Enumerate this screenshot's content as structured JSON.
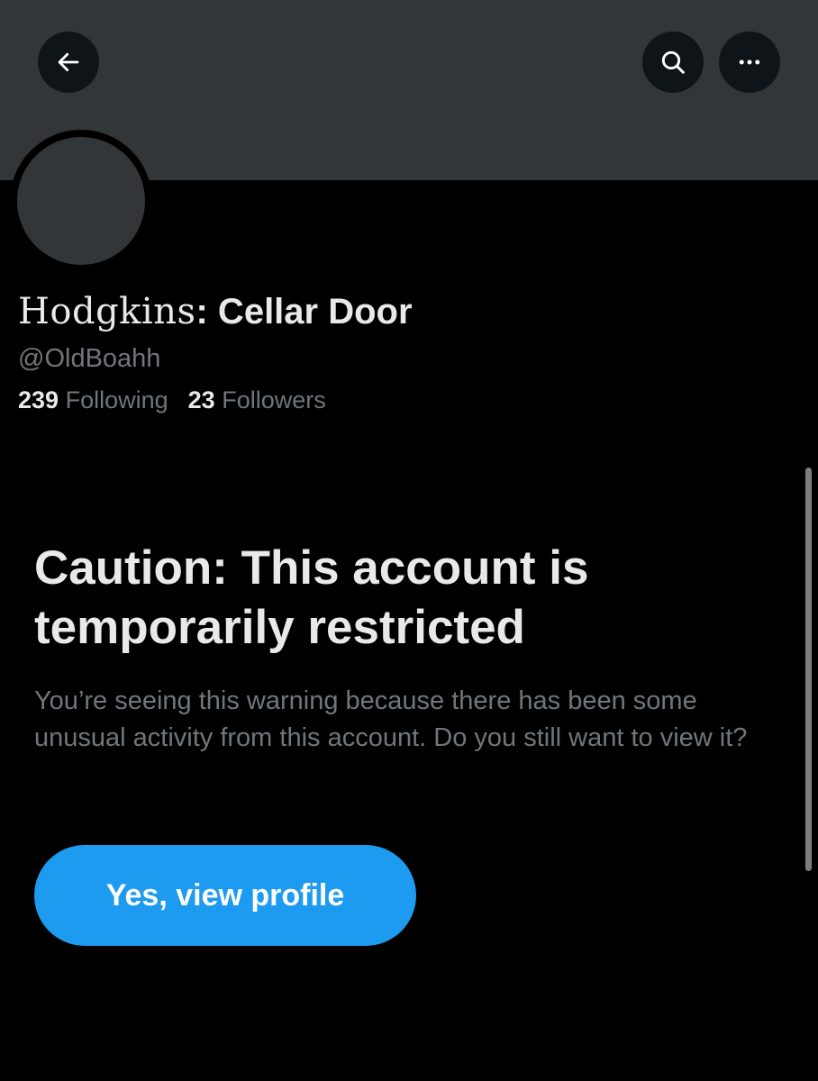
{
  "header": {
    "back_icon": "arrow-left-icon",
    "search_icon": "search-icon",
    "more_icon": "more-horizontal-icon"
  },
  "profile": {
    "display_name_fancy": "Hodgkins",
    "display_name_rest": ": Cellar Door",
    "handle": "@OldBoahh",
    "following_count": "239",
    "following_label": "Following",
    "followers_count": "23",
    "followers_label": "Followers"
  },
  "warning": {
    "title": "Caution: This account is temporarily restricted",
    "body": "You’re seeing this warning because there has been some unusual activity from this account. Do you still want to view it?",
    "button_label": "Yes, view profile"
  },
  "colors": {
    "background": "#000000",
    "banner": "#333639",
    "primary_text": "#e7e9ea",
    "secondary_text": "#71767b",
    "accent": "#1d9bf0"
  }
}
